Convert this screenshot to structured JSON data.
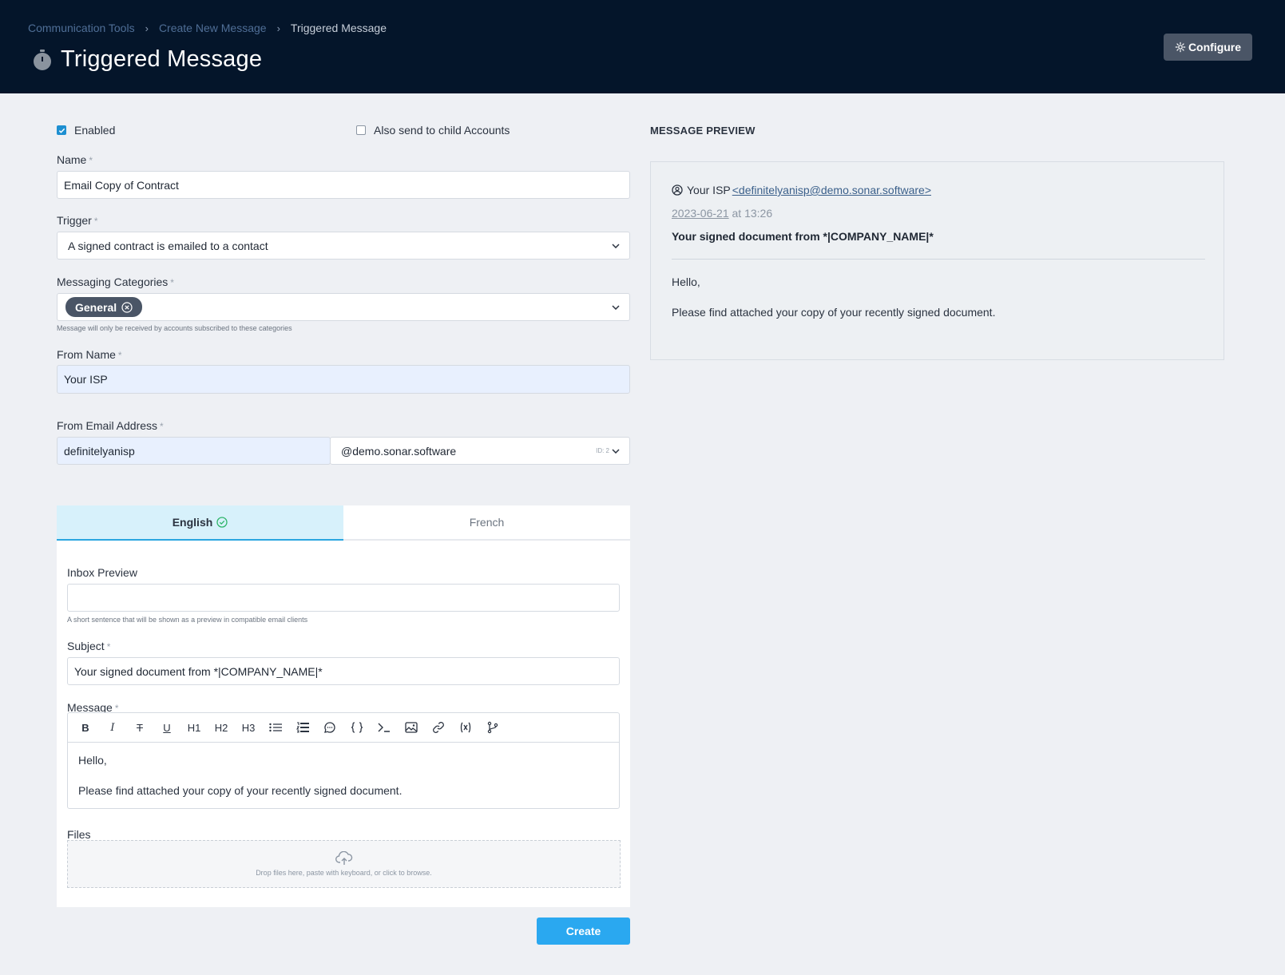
{
  "header": {
    "breadcrumb": [
      "Communication Tools",
      "Create New Message",
      "Triggered Message"
    ],
    "title": "Triggered Message",
    "configure_label": "Configure"
  },
  "form": {
    "enabled_label": "Enabled",
    "enabled_checked": true,
    "child_accounts_label": "Also send to child Accounts",
    "child_accounts_checked": false,
    "required_mark": "*",
    "name_label": "Name",
    "name_value": "Email Copy of Contract",
    "trigger_label": "Trigger",
    "trigger_value": "A signed contract is emailed to a contact",
    "categories_label": "Messaging Categories",
    "categories": [
      "General"
    ],
    "categories_hint": "Message will only be received by accounts subscribed to these categories",
    "from_name_label": "From Name",
    "from_name_value": "Your ISP",
    "from_email_label": "From Email Address",
    "from_email_local": "definitelyanisp",
    "from_email_domain": "@demo.sonar.software",
    "from_email_domain_id": "ID: 2"
  },
  "language_tabs": [
    {
      "label": "English",
      "active": true
    },
    {
      "label": "French",
      "active": false
    }
  ],
  "content": {
    "inbox_preview_label": "Inbox Preview",
    "inbox_preview_value": "",
    "inbox_preview_hint": "A short sentence that will be shown as a preview in compatible email clients",
    "subject_label": "Subject",
    "subject_value": "Your signed document from *|COMPANY_NAME|*",
    "message_label": "Message",
    "toolbar": [
      "B",
      "I",
      "T",
      "U",
      "H1",
      "H2",
      "H3"
    ],
    "message_lines": [
      "Hello,",
      "Please find attached your copy of your recently signed document."
    ],
    "files_label": "Files",
    "dropzone_text": "Drop files here, paste with keyboard, or click to browse."
  },
  "create_label": "Create",
  "preview": {
    "heading": "MESSAGE PREVIEW",
    "from_name": "Your ISP",
    "from_email": "<definitelyanisp@demo.sonar.software>",
    "date": "2023-06-21",
    "time": "at 13:26",
    "subject": "Your signed document from *|COMPANY_NAME|*",
    "body": [
      "Hello,",
      "Please find attached your copy of your recently signed document."
    ]
  }
}
